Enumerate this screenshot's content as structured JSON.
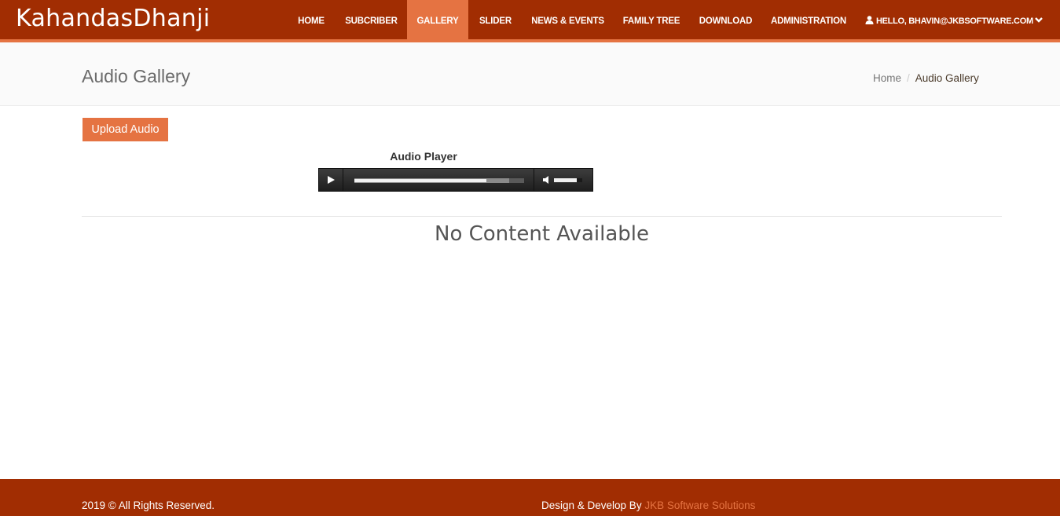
{
  "brand": "KahandasDhanji",
  "nav": {
    "items": [
      "HOME",
      "SUBCRIBER",
      "GALLERY",
      "SLIDER",
      "NEWS & EVENTS",
      "FAMILY TREE",
      "DOWNLOAD",
      "ADMINISTRATION"
    ],
    "active": "GALLERY",
    "user_label": "HELLO, BHAVIN@JKBSOFTWARE.COM"
  },
  "header": {
    "title": "Audio Gallery",
    "breadcrumb": [
      "Home",
      "Audio Gallery"
    ]
  },
  "main": {
    "upload_label": "Upload Audio",
    "player_label": "Audio Player",
    "player_progress": 0.78,
    "player_buffered": 0.91,
    "player_volume": 0.8,
    "empty_message": "No Content Available"
  },
  "footer": {
    "copyright": "2019 © All Rights Reserved.",
    "credit_prefix": "Design & Develop By",
    "credit_link": "JKB Software Solutions"
  },
  "colors": {
    "brand_dark": "#a12d02",
    "accent": "#e57342"
  }
}
